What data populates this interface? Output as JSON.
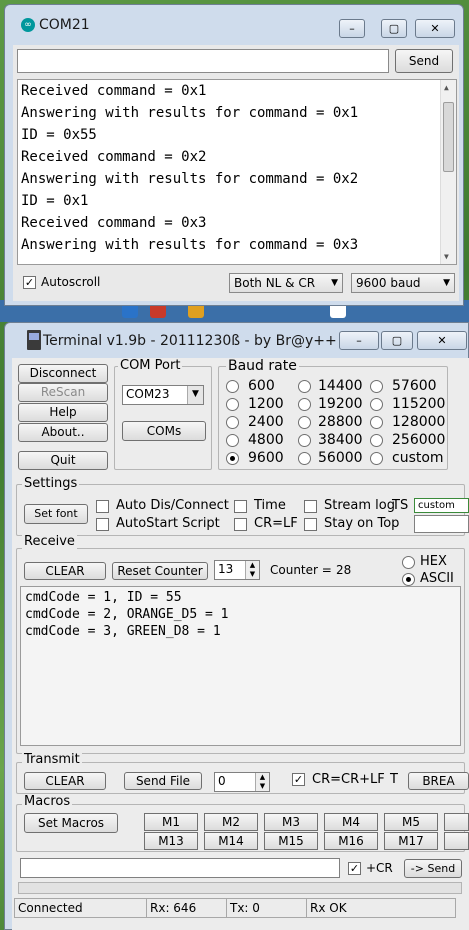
{
  "serial_monitor": {
    "title": "COM21",
    "send_label": "Send",
    "input_value": "",
    "lines": [
      "Received command = 0x1",
      "Answering with results for command = 0x1",
      "ID = 0x55",
      "Received command = 0x2",
      "Answering with results for command = 0x2",
      "ID = 0x1",
      "Received command = 0x3",
      "Answering with results for command = 0x3"
    ],
    "autoscroll_label": "Autoscroll",
    "autoscroll_checked": true,
    "line_ending": "Both NL & CR",
    "baud": "9600 baud"
  },
  "terminal": {
    "title": "Terminal v1.9b - 20111230ß - by Br@y++",
    "buttons": {
      "disconnect": "Disconnect",
      "rescan": "ReScan",
      "help": "Help",
      "about": "About..",
      "quit": "Quit"
    },
    "com_port": {
      "label": "COM Port",
      "value": "COM23",
      "coms_button": "COMs"
    },
    "baud_rate": {
      "label": "Baud rate",
      "options": [
        "600",
        "14400",
        "57600",
        "1200",
        "19200",
        "115200",
        "2400",
        "28800",
        "128000",
        "4800",
        "38400",
        "256000",
        "9600",
        "56000",
        "custom"
      ],
      "selected": "9600"
    },
    "settings": {
      "label": "Settings",
      "set_font": "Set font",
      "auto_dis_connect": "Auto Dis/Connect",
      "autostart_script": "AutoStart Script",
      "time": "Time",
      "cr_lf": "CR=LF",
      "stream_log": "Stream log",
      "ts": "TS",
      "stay_on_top": "Stay on Top",
      "custom": "custom"
    },
    "receive": {
      "label": "Receive",
      "clear": "CLEAR",
      "reset_counter": "Reset Counter",
      "counter_spin": "13",
      "counter_label": "Counter =",
      "counter_value": "28",
      "hex": "HEX",
      "ascii": "ASCII",
      "lines": [
        "cmdCode = 1, ID = 55",
        "cmdCode = 2, ORANGE_D5 = 1",
        "cmdCode = 3, GREEN_D8 = 1"
      ]
    },
    "transmit": {
      "label": "Transmit",
      "clear": "CLEAR",
      "send_file": "Send File",
      "spin_value": "0",
      "cr_label": "CR=CR+LF",
      "t_label": "T",
      "break_label": "BREA"
    },
    "macros": {
      "label": "Macros",
      "set_macros": "Set Macros",
      "row1": [
        "M1",
        "M2",
        "M3",
        "M4",
        "M5"
      ],
      "row2": [
        "M13",
        "M14",
        "M15",
        "M16",
        "M17"
      ]
    },
    "send_bar": {
      "input_value": "",
      "cr_label": "+CR",
      "send_label": "-> Send"
    },
    "status": {
      "connected": "Connected",
      "rx": "Rx: 646",
      "tx": "Tx: 0",
      "rx_ok": "Rx OK"
    }
  },
  "colors": {
    "window_frame": "#cfdcec",
    "client": "#ececec",
    "arduino_teal": "#00979c"
  }
}
